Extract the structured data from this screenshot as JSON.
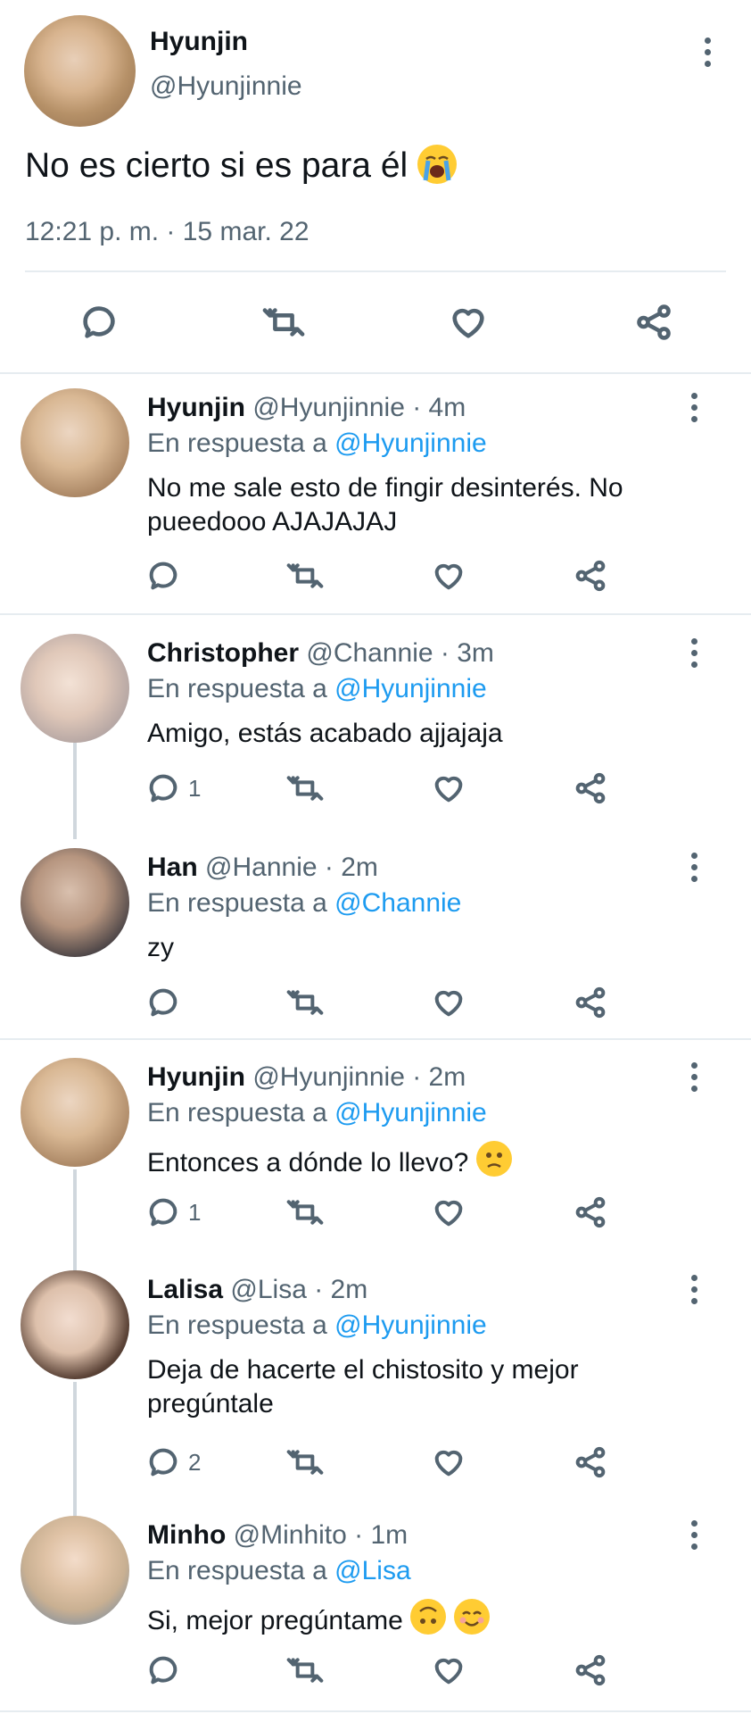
{
  "main_tweet": {
    "name": "Hyunjin",
    "handle": "@Hyunjinnie",
    "text": "No es cierto si es para él",
    "emoji": "loudly-crying-face",
    "time": "12:21 p. m. · 15 mar. 22"
  },
  "replies": [
    {
      "name": "Hyunjin",
      "meta": "@Hyunjinnie · 4m",
      "reply_prefix": "En respuesta a",
      "reply_to": "@Hyunjinnie",
      "text": "No me sale esto de fingir desinterés. No pueedooo AJAJAJAJ",
      "reply_count": ""
    },
    {
      "name": "Christopher",
      "meta": "@Channie · 3m",
      "reply_prefix": "En respuesta a",
      "reply_to": "@Hyunjinnie",
      "text": "Amigo, estás acabado ajjajaja",
      "reply_count": "1"
    },
    {
      "name": "Han",
      "meta": "@Hannie · 2m",
      "reply_prefix": "En respuesta a",
      "reply_to": "@Channie",
      "text": "zy",
      "reply_count": ""
    },
    {
      "name": "Hyunjin",
      "meta": "@Hyunjinnie · 2m",
      "reply_prefix": "En respuesta a",
      "reply_to": "@Hyunjinnie",
      "text": "Entonces a dónde lo llevo?",
      "emoji": "confused-face",
      "reply_count": "1"
    },
    {
      "name": "Lalisa",
      "meta": "@Lisa · 2m",
      "reply_prefix": "En respuesta a",
      "reply_to": "@Hyunjinnie",
      "text": "Deja de hacerte el chistosito y mejor pregúntale",
      "reply_count": "2"
    },
    {
      "name": "Minho",
      "meta": "@Minhito · 1m",
      "reply_prefix": "En respuesta a",
      "reply_to": "@Lisa",
      "text": "Si, mejor pregúntame",
      "emoji": "upside-down-face, smiling-face",
      "reply_count": ""
    }
  ],
  "colors": {
    "link": "#1d9bf0",
    "muted": "#536471",
    "text": "#0f1419",
    "divider": "#e6ecf0"
  }
}
